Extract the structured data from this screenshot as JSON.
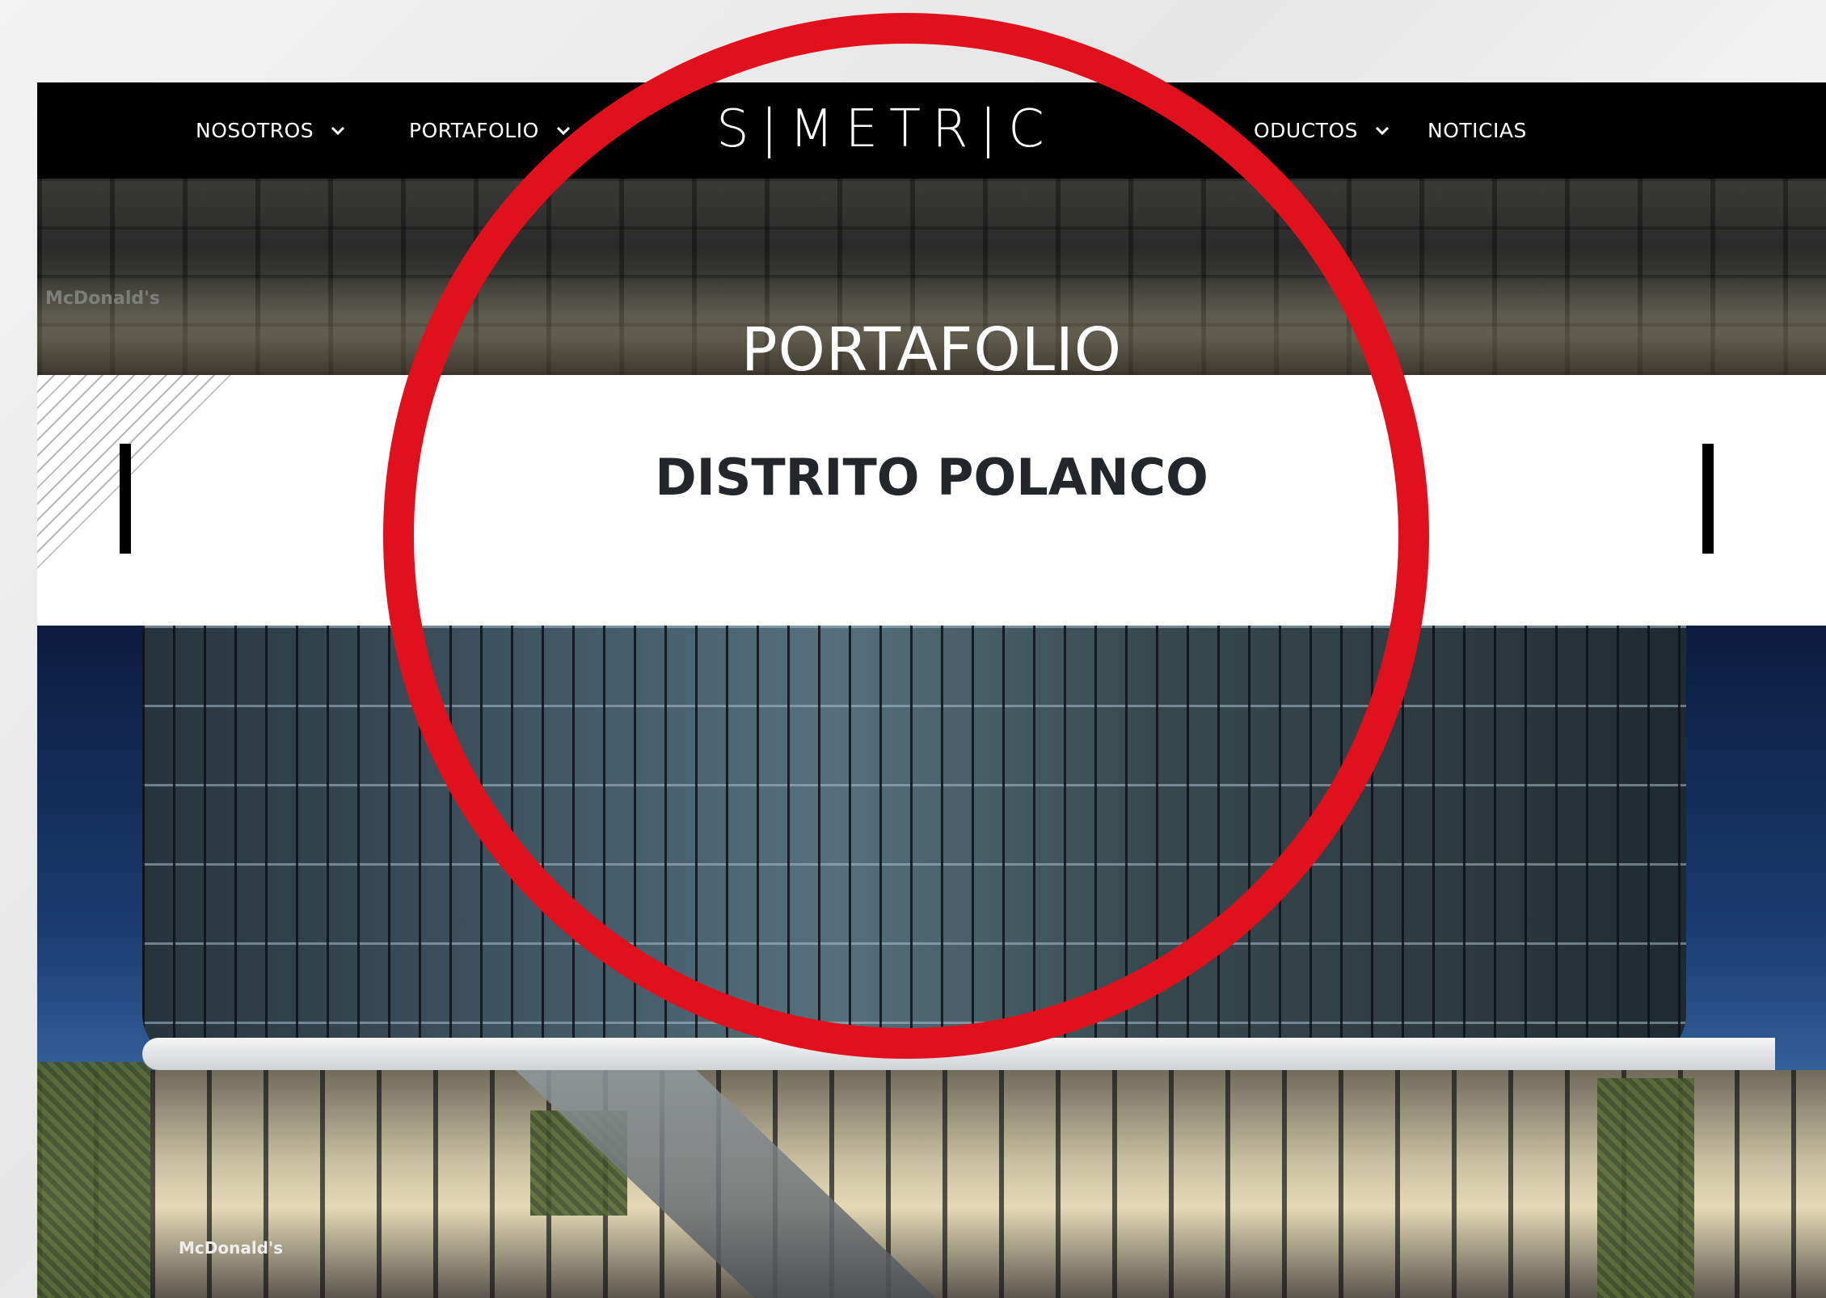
{
  "nav": {
    "items": [
      {
        "label": "NOSOTROS",
        "has_dropdown": true
      },
      {
        "label": "PORTAFOLIO",
        "has_dropdown": true
      },
      {
        "label": "ODUCTOS",
        "has_dropdown": true
      },
      {
        "label": "NOTICIAS",
        "has_dropdown": false
      }
    ],
    "logo_text": "S|METR|C",
    "dropdown_icon": "chevron-down-icon"
  },
  "hero": {
    "title": "PORTAFOLIO",
    "background_sign": "McDonald's"
  },
  "project": {
    "title": "DISTRITO POLANCO"
  },
  "building_image": {
    "sign_text": "McDonald's"
  },
  "annotation": {
    "circle_color": "#e1101d"
  },
  "colors": {
    "nav_background": "#000000",
    "nav_text": "#ffffff",
    "project_title": "#23262b",
    "accent_bars": "#000000"
  }
}
